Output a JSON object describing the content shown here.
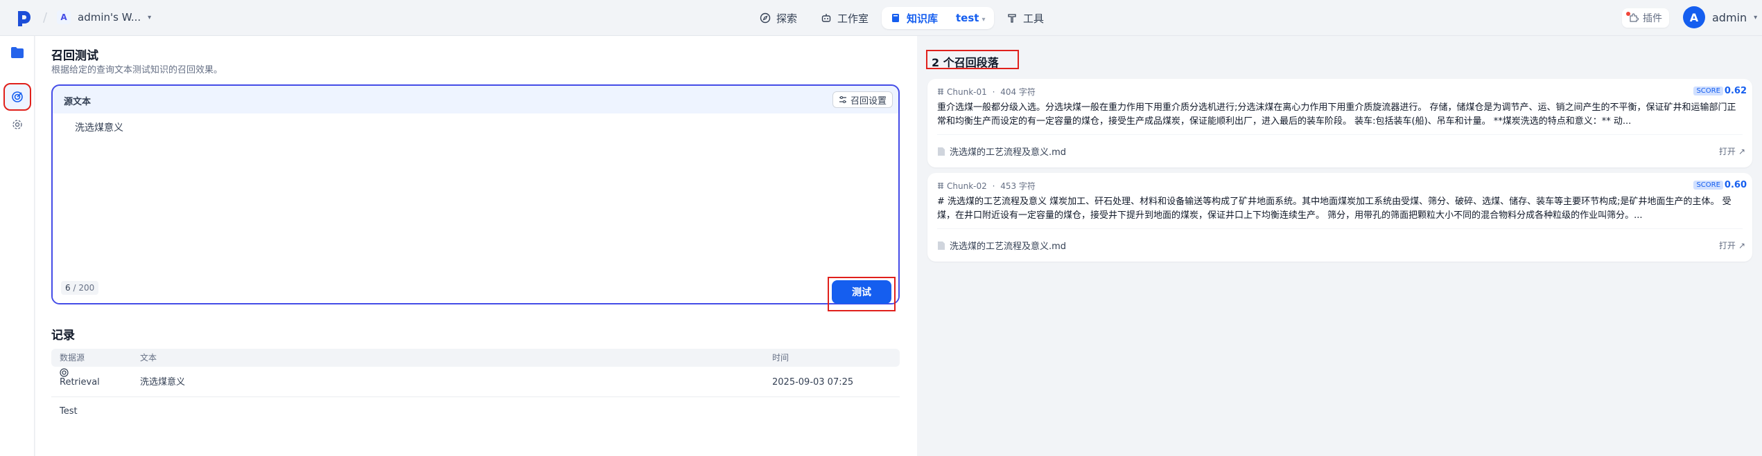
{
  "header": {
    "workspace_initial": "A",
    "workspace_name": "admin's W...",
    "nav": [
      {
        "label": "探索"
      },
      {
        "label": "工作室"
      },
      {
        "label": "知识库",
        "sub": "test"
      },
      {
        "label": "工具"
      }
    ],
    "plugin_label": "插件",
    "user_initial": "A",
    "user_name": "admin"
  },
  "main": {
    "title": "召回测试",
    "description": "根据给定的查询文本测试知识的召回效果。",
    "source_label": "源文本",
    "recall_settings_label": "召回设置",
    "query_text": "洗选煤意义",
    "count_current": "6",
    "count_max": "/ 200",
    "test_button": "测试"
  },
  "records": {
    "title": "记录",
    "columns": [
      "数据源",
      "文本",
      "时间"
    ],
    "rows": [
      {
        "source": "Retrieval Test",
        "text": "洗选煤意义",
        "time": "2025-09-03 07:25"
      }
    ]
  },
  "results": {
    "title": "2 个召回段落",
    "score_label": "SCORE",
    "open_label": "打开",
    "chunks": [
      {
        "id": "Chunk-01",
        "chars": "404 字符",
        "score": "0.62",
        "content": "重介选煤一般都分级入选。分选块煤一般在重力作用下用重介质分选机进行;分选沫煤在离心力作用下用重介质旋流器进行。 存储，储煤仓是为调节产、运、销之间产生的不平衡，保证矿井和运输部门正常和均衡生产而设定的有一定容量的煤仓，接受生产成品煤炭，保证能顺利出厂，进入最后的装车阶段。 装车:包括装车(船)、吊车和计量。 **煤炭洗选的特点和意义：** 动...",
        "file": "洗选煤的工艺流程及意义.md"
      },
      {
        "id": "Chunk-02",
        "chars": "453 字符",
        "score": "0.60",
        "content": "# 洗选煤的工艺流程及意义 煤炭加工、矸石处理、材料和设备输送等构成了矿井地面系统。其中地面煤炭加工系统由受煤、筛分、破碎、选煤、储存、装车等主要环节构成;是矿井地面生产的主体。 受煤，在井口附近设有一定容量的煤仓，接受井下提升到地面的煤炭，保证井口上下均衡连续生产。 筛分，用带孔的筛面把颗粒大小不同的混合物料分成各种粒级的作业叫筛分。...",
        "file": "洗选煤的工艺流程及意义.md"
      }
    ]
  }
}
